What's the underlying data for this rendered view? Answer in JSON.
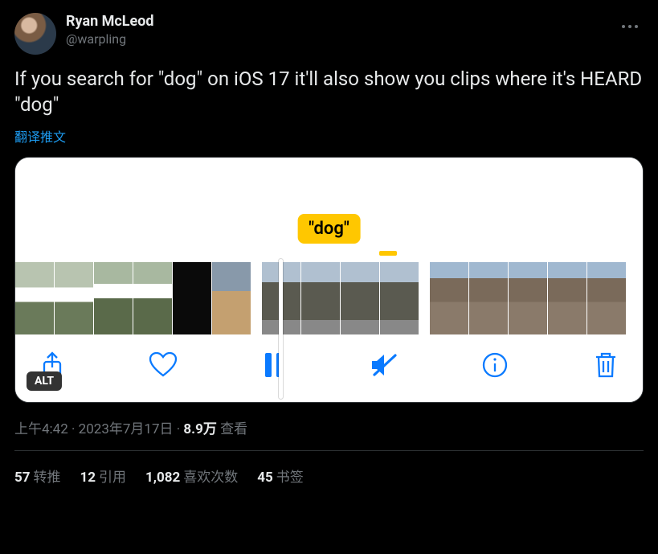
{
  "author": {
    "name": "Ryan McLeod",
    "handle": "@warpling"
  },
  "tweet_text": "If you search for \"dog\" on iOS 17 it'll also show you clips where it's HEARD \"dog\"",
  "translate_label": "翻译推文",
  "media": {
    "search_term_badge": "\"dog\"",
    "alt_label": "ALT"
  },
  "meta": {
    "time": "上午4:42",
    "date": "2023年7月17日",
    "views_count": "8.9万",
    "views_label": "查看",
    "separator": " · "
  },
  "stats": {
    "retweets_count": "57",
    "retweets_label": "转推",
    "quotes_count": "12",
    "quotes_label": "引用",
    "likes_count": "1,082",
    "likes_label": "喜欢次数",
    "bookmarks_count": "45",
    "bookmarks_label": "书签"
  }
}
